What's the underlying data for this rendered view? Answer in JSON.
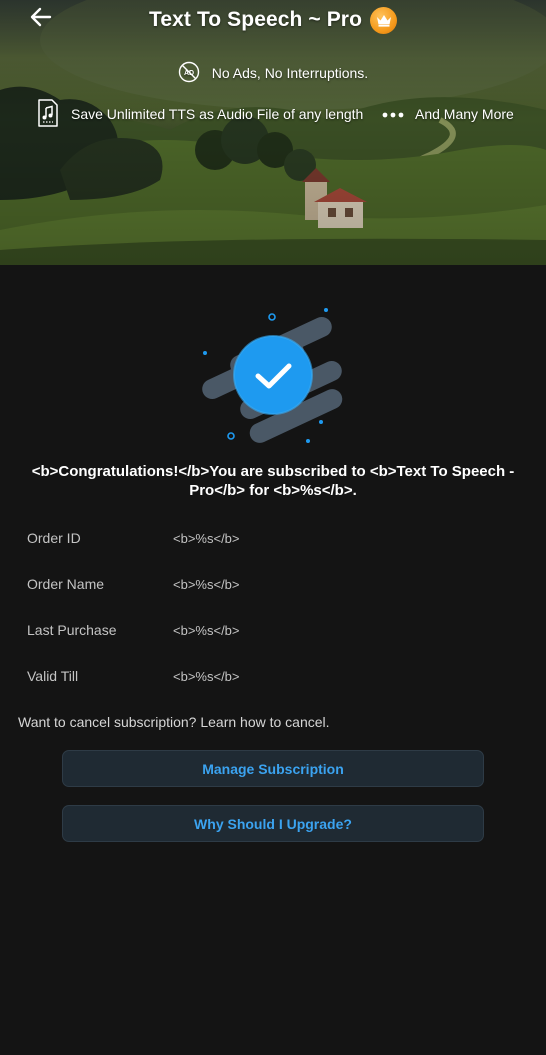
{
  "header": {
    "title": "Text To Speech ~ Pro",
    "features": [
      {
        "icon": "no-ads-icon",
        "text": "No Ads, No Interruptions."
      },
      {
        "icon": "audio-file-icon",
        "text": "Save Unlimited TTS as Audio File of any length"
      },
      {
        "icon": "more-dots-icon",
        "text": "And Many More"
      }
    ]
  },
  "success": {
    "message": "<b>Congratulations!</b>You are subscribed to <b>Text To Speech - Pro</b> for <b>%s</b>."
  },
  "details": [
    {
      "label": "Order ID",
      "value": "<b>%s</b>"
    },
    {
      "label": "Order Name",
      "value": "<b>%s</b>"
    },
    {
      "label": "Last Purchase",
      "value": "<b>%s</b>"
    },
    {
      "label": "Valid Till",
      "value": "<b>%s</b>"
    }
  ],
  "cancel_note": "Want to cancel subscription? Learn how to cancel.",
  "buttons": {
    "manage": "Manage Subscription",
    "why_upgrade": "Why Should I Upgrade?"
  },
  "colors": {
    "background": "#141414",
    "accent": "#3ba3f0",
    "button_bg": "#1f2a33",
    "check_circle": "#1e9af0",
    "crown_badge": "#f59a1c"
  }
}
